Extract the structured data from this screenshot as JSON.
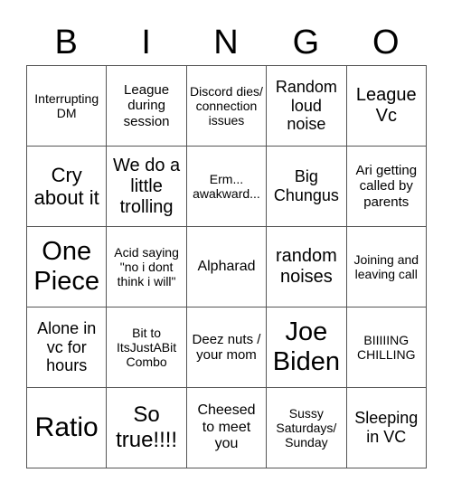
{
  "header": {
    "letters": [
      "B",
      "I",
      "N",
      "G",
      "O"
    ]
  },
  "board": {
    "rows": [
      [
        "Interrupting DM",
        "League during session",
        "Discord dies/ connection issues",
        "Random loud noise",
        "League Vc"
      ],
      [
        "Cry about it",
        "We do a little trolling",
        "Erm... awakward...",
        "Big Chungus",
        "Ari getting called by parents"
      ],
      [
        "One Piece",
        "Acid saying \"no i dont think i will\"",
        "Alpharad",
        "random noises",
        "Joining and leaving call"
      ],
      [
        "Alone in vc for hours",
        "Bit to ItsJustABit Combo",
        "Deez nuts / your mom",
        "Joe Biden",
        "BIIIIING CHILLING"
      ],
      [
        "Ratio",
        "So true!!!!",
        "Cheesed to meet you",
        "Sussy Saturdays/ Sunday",
        "Sleeping in VC"
      ]
    ]
  }
}
